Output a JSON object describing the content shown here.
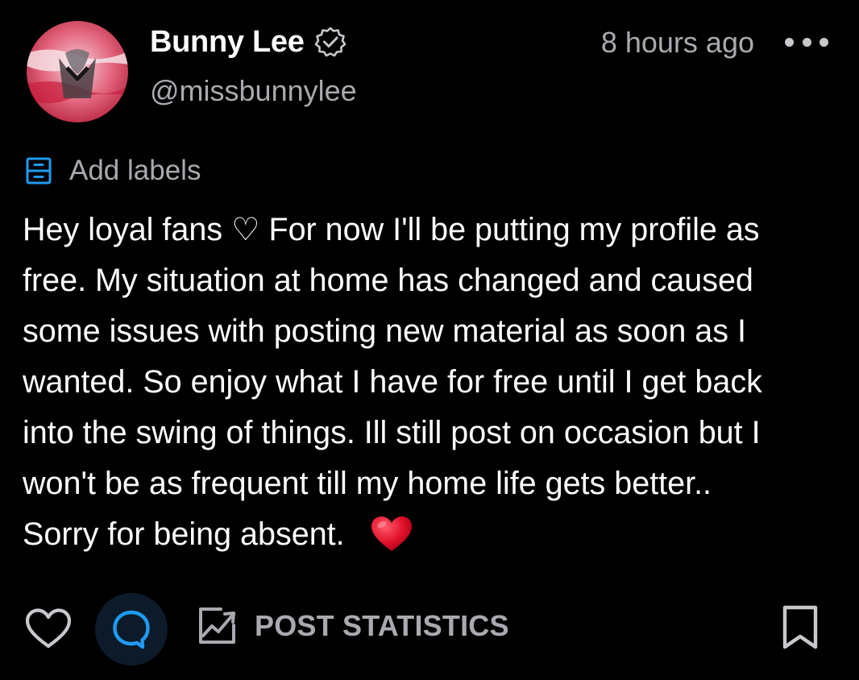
{
  "post": {
    "author": {
      "display_name": "Bunny Lee",
      "handle": "@missbunnylee",
      "verified_icon": "verified-badge-icon"
    },
    "timestamp": "8 hours ago",
    "labels_action": "Add labels",
    "text": "Hey loyal fans ♡ For now I'll be putting my profile as\nfree. My situation at home has changed and caused\nsome issues with posting new material as soon as I\nwanted. So enjoy what I have for free until I get back\ninto the swing of things. Ill still post on occasion but I\nwon't be as frequent till my home life gets better..\nSorry for being absent.",
    "emoji": "red-heart-emoji"
  },
  "actions": {
    "like_icon": "heart-outline-icon",
    "comment_icon": "comment-bubble-icon",
    "stats_label": "POST STATISTICS",
    "stats_icon": "chart-image-icon",
    "bookmark_icon": "bookmark-icon"
  },
  "colors": {
    "background": "#000000",
    "text_primary": "#ffffff",
    "text_secondary": "#a8aaaf",
    "accent_blue": "#1f9bf0",
    "heart_red": "#e0102a"
  }
}
